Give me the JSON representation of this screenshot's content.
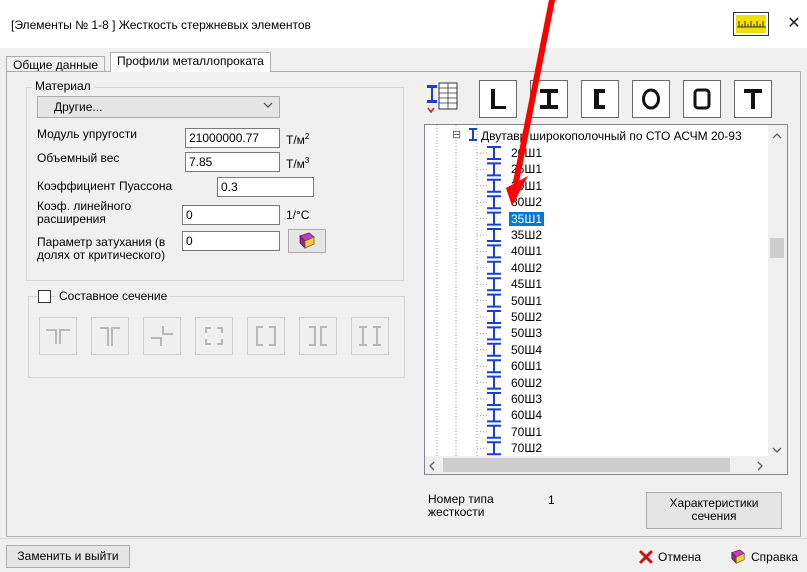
{
  "window": {
    "title": "[Элементы № 1-8 ] Жесткость стержневых элементов",
    "close_glyph": "✕"
  },
  "tabs": [
    {
      "label": "Общие данные",
      "active": false
    },
    {
      "label": "Профили металлопроката",
      "active": true
    }
  ],
  "material": {
    "group_label": "Материал",
    "selected": "Другие...",
    "fields": [
      {
        "label": "Модуль упругости",
        "value": "21000000.77",
        "unit": "Т/м",
        "unit_sup": "2"
      },
      {
        "label": "Объемный вес",
        "value": "7.85",
        "unit": "Т/м",
        "unit_sup": "3"
      },
      {
        "label": "Коэффициент Пуассона",
        "value": "0.3",
        "unit": "",
        "unit_sup": ""
      },
      {
        "label_line1": "Коэф. линейного",
        "label_line2": "расширения",
        "value": "0",
        "unit": "1/°C",
        "unit_sup": ""
      },
      {
        "label_line1": "Параметр затухания (в",
        "label_line2": "долях от критического)",
        "value": "0",
        "unit": "",
        "unit_sup": ""
      }
    ]
  },
  "composite": {
    "label": "Составное сечение",
    "checked": false
  },
  "tree": {
    "root_label": "Двутавр широкополочный по СТО АСЧМ 20-93",
    "root_collapse_glyph": "⊟",
    "items": [
      "20Ш1",
      "25Ш1",
      "30Ш1",
      "30Ш2",
      "35Ш1",
      "35Ш2",
      "40Ш1",
      "40Ш2",
      "45Ш1",
      "50Ш1",
      "50Ш2",
      "50Ш3",
      "50Ш4",
      "60Ш1",
      "60Ш2",
      "60Ш3",
      "60Ш4",
      "70Ш1",
      "70Ш2"
    ],
    "selected_index": 4
  },
  "bottom": {
    "type_number_label_line1": "Номер типа",
    "type_number_label_line2": "жесткости",
    "type_number_value": "1",
    "characteristics_line1": "Характеристики",
    "characteristics_line2": "сечения"
  },
  "footer": {
    "replace_label": "Заменить и выйти",
    "cancel_label": "Отмена",
    "help_label": "Справка"
  },
  "colors": {
    "accent_selection": "#0078d7",
    "profile_icon_blue": "#1a3fd1",
    "annotation_arrow": "#ff0000"
  }
}
